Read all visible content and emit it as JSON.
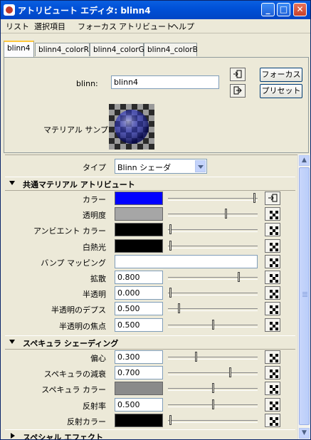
{
  "window": {
    "title": "アトリビュート エディタ: blinn4"
  },
  "menu": [
    "リスト",
    "選択項目",
    "フォーカス",
    "アトリビュート",
    "ヘルプ"
  ],
  "tabs": [
    "blinn4",
    "blinn4_colorR",
    "blinn4_colorG",
    "blinn4_colorB"
  ],
  "node": {
    "label": "blinn:",
    "value": "blinn4",
    "focus_button": "フォーカス",
    "preset_button": "プリセット",
    "sample_label": "マテリアル サンプル"
  },
  "type_row": {
    "label": "タイプ",
    "value": "Blinn シェーダ"
  },
  "common": {
    "title": "共通マテリアル アトリビュート",
    "rows": [
      {
        "label": "カラー",
        "kind": "color",
        "color": "#0000ff",
        "slider": 0.98
      },
      {
        "label": "透明度",
        "kind": "color",
        "color": "#a6a6a6",
        "slider": 0.65
      },
      {
        "label": "アンビエント カラー",
        "kind": "color",
        "color": "#000000",
        "slider": 0.0
      },
      {
        "label": "白熱光",
        "kind": "color",
        "color": "#000000",
        "slider": 0.0
      },
      {
        "label": "バンプ マッピング",
        "kind": "field",
        "value": ""
      },
      {
        "label": "拡散",
        "kind": "number",
        "value": "0.800",
        "slider": 0.8
      },
      {
        "label": "半透明",
        "kind": "number",
        "value": "0.000",
        "slider": 0.0
      },
      {
        "label": "半透明のデプス",
        "kind": "number",
        "value": "0.500",
        "slider": 0.1
      },
      {
        "label": "半透明の焦点",
        "kind": "number",
        "value": "0.500",
        "slider": 0.5
      }
    ]
  },
  "specular": {
    "title": "スペキュラ シェーディング",
    "rows": [
      {
        "label": "偏心",
        "kind": "number",
        "value": "0.300",
        "slider": 0.3
      },
      {
        "label": "スペキュラの減衰",
        "kind": "number",
        "value": "0.700",
        "slider": 0.7
      },
      {
        "label": "スペキュラ カラー",
        "kind": "color",
        "color": "#8a8a8a",
        "slider": 0.5
      },
      {
        "label": "反射率",
        "kind": "number",
        "value": "0.500",
        "slider": 0.5
      },
      {
        "label": "反射カラー",
        "kind": "color",
        "color": "#000000",
        "slider": 0.0
      }
    ]
  },
  "special": {
    "title": "スペシャル エフェクト"
  }
}
